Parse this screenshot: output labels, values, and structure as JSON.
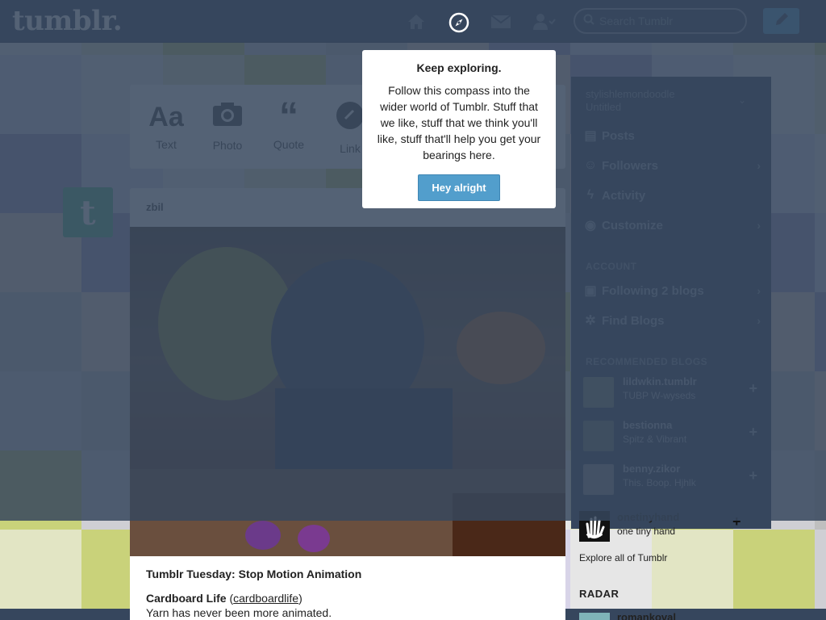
{
  "header": {
    "logo": "tumblr.",
    "search_placeholder": "Search Tumblr",
    "nav": [
      "home-icon",
      "compass-icon",
      "mail-icon",
      "account-icon"
    ],
    "post_button_icon": "pencil-icon"
  },
  "colors": {
    "navy": "#36465d",
    "accent": "#529ecc",
    "tumblr_green": "#56bc8a"
  },
  "post_form": {
    "types": [
      {
        "icon": "text-icon",
        "glyph": "Aa",
        "label": "Text"
      },
      {
        "icon": "camera-icon",
        "glyph": "",
        "label": "Photo"
      },
      {
        "icon": "quote-icon",
        "glyph": "“",
        "label": "Quote"
      },
      {
        "icon": "link-icon",
        "glyph": "",
        "label": "Link"
      }
    ]
  },
  "post": {
    "author": "zbil",
    "title": "Tumblr Tuesday: Stop Motion Animation",
    "blog_name": "Cardboard Life",
    "blog_handle": "cardboardlife",
    "caption": "Yarn has never been more animated."
  },
  "sidebar": {
    "blog_name": "stylishlemondoodle",
    "blog_sub": "Untitled",
    "items": [
      {
        "icon": "posts-icon",
        "label": "Posts",
        "arrow": ""
      },
      {
        "icon": "followers-icon",
        "label": "Followers",
        "arrow": "›"
      },
      {
        "icon": "activity-icon",
        "label": "Activity",
        "arrow": ""
      },
      {
        "icon": "eye-icon",
        "label": "Customize",
        "arrow": "›"
      }
    ],
    "account_heading": "ACCOUNT",
    "account_items": [
      {
        "icon": "following-icon",
        "label": "Following 2 blogs",
        "arrow": "›"
      },
      {
        "icon": "find-icon",
        "label": "Find Blogs",
        "arrow": "›"
      }
    ],
    "recommended_heading": "RECOMMENDED BLOGS",
    "recommended": [
      {
        "name": "lildwkin.tumblr",
        "desc": "TUBP W-wyseds",
        "color": "#7a8577"
      },
      {
        "name": "bestionna",
        "desc": "Spitz & Vibrant",
        "color": "#6e7a70"
      },
      {
        "name": "benny.zikor",
        "desc": "This. Boop. Hjhlk",
        "color": "#8a8f96"
      },
      {
        "name": "onetinyhand",
        "desc": "one tiny hand",
        "color": "#111111"
      }
    ],
    "explore": "Explore all of Tumblr",
    "radar_heading": "RADAR",
    "radar_name": "romankoval"
  },
  "popover": {
    "title": "Keep exploring.",
    "body": "Follow this compass into the wider world of Tumblr. Stuff that we like, stuff that we think you'll like, stuff that'll help you get your bearings here.",
    "button": "Hey alright"
  }
}
